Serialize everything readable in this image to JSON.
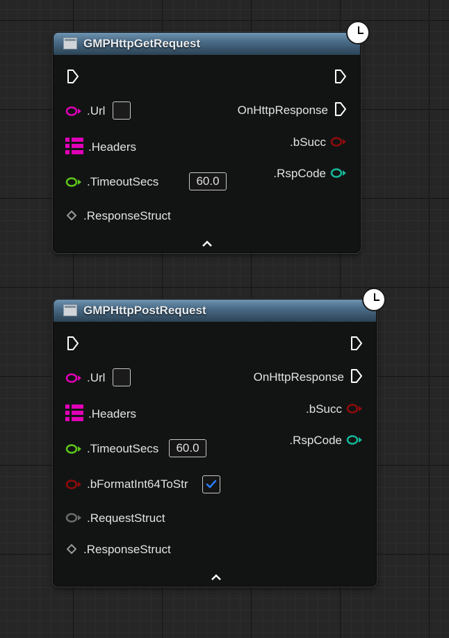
{
  "nodes": [
    {
      "title": "GMPHttpGetRequest",
      "inputs": {
        "url": ".Url",
        "headers": ".Headers",
        "timeout": ".TimeoutSecs",
        "timeout_value": "60.0",
        "response_struct": ".ResponseStruct"
      },
      "outputs": {
        "on_http_response": "OnHttpResponse",
        "b_succ": ".bSucc",
        "rsp_code": ".RspCode"
      }
    },
    {
      "title": "GMPHttpPostRequest",
      "inputs": {
        "url": ".Url",
        "headers": ".Headers",
        "timeout": ".TimeoutSecs",
        "timeout_value": "60.0",
        "format_int64": ".bFormatInt64ToStr",
        "format_int64_checked": true,
        "request_struct": ".RequestStruct",
        "response_struct": ".ResponseStruct"
      },
      "outputs": {
        "on_http_response": "OnHttpResponse",
        "b_succ": ".bSucc",
        "rsp_code": ".RspCode"
      }
    }
  ],
  "pin_colors": {
    "string": "#e100b8",
    "float": "#5ec71a",
    "bool": "#910b0b",
    "int": "#15b89a",
    "struct": "#6b6b6b",
    "wildcard": "#9a9a9a",
    "exec": "#ffffff"
  }
}
